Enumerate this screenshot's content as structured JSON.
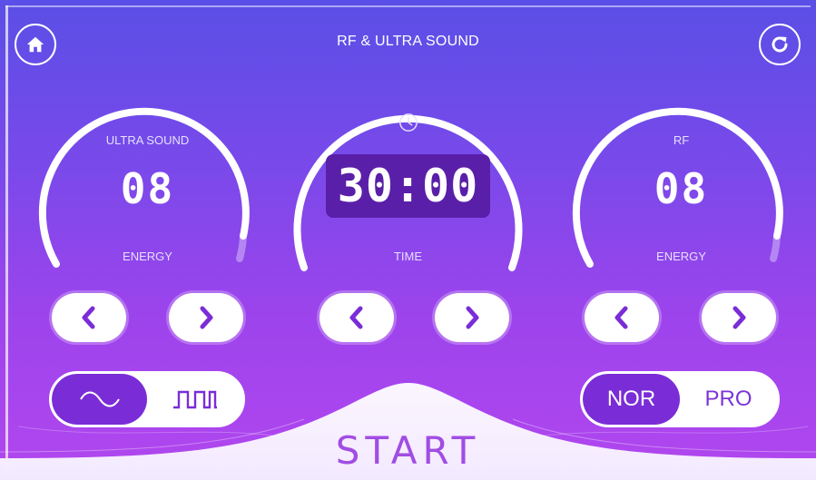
{
  "header": {
    "title": "RF & ULTRA SOUND",
    "home_icon": "home-icon",
    "refresh_icon": "refresh-icon"
  },
  "ultrasound": {
    "label": "ULTRA SOUND",
    "value": "08",
    "sublabel": "ENERGY"
  },
  "timer": {
    "value": "30:00",
    "sublabel": "TIME",
    "clock_icon": "clock-icon"
  },
  "rf": {
    "label": "RF",
    "value": "08",
    "sublabel": "ENERGY"
  },
  "wave_toggle": {
    "options": [
      "sine-wave-icon",
      "square-wave-icon"
    ],
    "selected": "sine-wave-icon"
  },
  "mode_toggle": {
    "options": [
      "NOR",
      "PRO"
    ],
    "selected": "NOR"
  },
  "start_label": "START",
  "colors": {
    "accent": "#7a2dd6",
    "background_top": "#5a4fe6",
    "background_bottom": "#b246ef",
    "start_text": "#a14de3"
  }
}
